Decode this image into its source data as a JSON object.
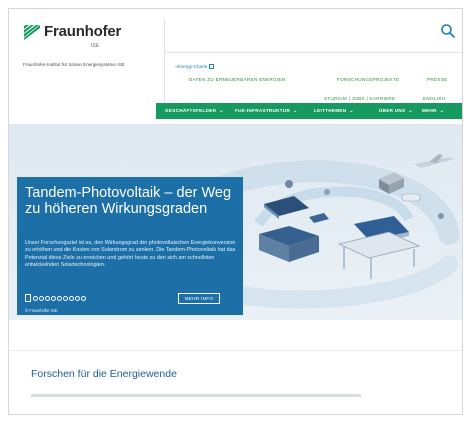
{
  "logo": {
    "name": "Fraunhofer",
    "suffix": "ISE"
  },
  "institute": "Fraunhofer-Institut für Solare Energiesysteme ISE",
  "header": {
    "energy_charts": "»Energy-Charts",
    "links": [
      "DATEN ZU ERNEUERBAREN ENERGIEN",
      "FORSCHUNGSPROJEKTE",
      "PRESSE",
      "STUDIUM | JOBS | KARRIERE",
      "ENGLISH"
    ]
  },
  "nav": {
    "items": [
      "GESCHÄFTSFELDER",
      "FUE-INFRASTRUKTUR",
      "LEITTHEMEN",
      "ÜBER UNS",
      "MEHR"
    ]
  },
  "hero": {
    "title": "Tandem-Photovoltaik – der Weg zu höheren Wirkungsgraden",
    "text": "Unser Forschungsziel ist es, den Wirkungsgrad der photovoltaischen Energiekonversion zu erhöhen und die Kosten von Solarstrom zu senken. Die Tandem-Photovoltaik hat das Potenzial diese Ziele zu erreichen und gehört heute zu den sich am schnellsten entwickelnden Solartechnologien.",
    "button": "MEHR INFO",
    "credit": "© Fraunhofer ISE"
  },
  "section": {
    "title": "Forschen für die Energiewende"
  },
  "colors": {
    "brand_green": "#179a5f",
    "hero_blue": "#1d6fa8",
    "link_blue": "#1d7fb7"
  }
}
